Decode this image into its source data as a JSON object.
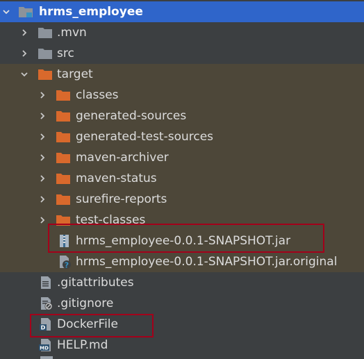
{
  "colors": {
    "background": "#3c3f41",
    "selected_row": "#2f65ca",
    "excluded_row": "#4d4739",
    "folder_gray": "#8c939b",
    "folder_orange": "#d9692c",
    "highlight": "#a3001a"
  },
  "tree": {
    "root": {
      "label": "hrms_employee",
      "icon": "module-folder-icon"
    },
    "mvn": {
      "label": ".mvn",
      "icon": "folder-icon"
    },
    "src": {
      "label": "src",
      "icon": "folder-icon"
    },
    "target": {
      "label": "target",
      "icon": "excluded-folder-icon"
    },
    "classes": {
      "label": "classes",
      "icon": "excluded-folder-icon"
    },
    "generated_sources": {
      "label": "generated-sources",
      "icon": "excluded-folder-icon"
    },
    "generated_test_sources": {
      "label": "generated-test-sources",
      "icon": "excluded-folder-icon"
    },
    "maven_archiver": {
      "label": "maven-archiver",
      "icon": "excluded-folder-icon"
    },
    "maven_status": {
      "label": "maven-status",
      "icon": "excluded-folder-icon"
    },
    "surefire_reports": {
      "label": "surefire-reports",
      "icon": "excluded-folder-icon"
    },
    "test_classes": {
      "label": "test-classes",
      "icon": "excluded-folder-icon"
    },
    "jar": {
      "label": "hrms_employee-0.0.1-SNAPSHOT.jar",
      "icon": "jar-archive-icon"
    },
    "jar_original": {
      "label": "hrms_employee-0.0.1-SNAPSHOT.jar.original",
      "icon": "unknown-file-icon"
    },
    "gitattributes": {
      "label": ".gitattributes",
      "icon": "text-file-icon"
    },
    "gitignore": {
      "label": ".gitignore",
      "icon": "ignore-file-icon"
    },
    "dockerfile": {
      "label": "DockerFile",
      "icon": "docker-file-icon"
    },
    "help": {
      "label": "HELP.md",
      "icon": "markdown-file-icon",
      "badge": "MD"
    }
  }
}
